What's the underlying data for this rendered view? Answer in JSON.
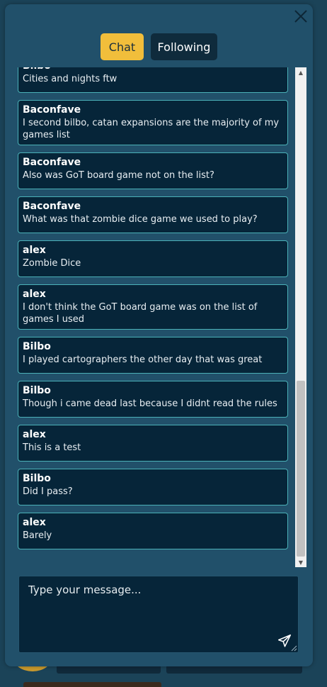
{
  "tabs": {
    "chat": "Chat",
    "following": "Following"
  },
  "messages": [
    {
      "author": "Bilbo",
      "text": "Cities and nights ftw"
    },
    {
      "author": "Baconfave",
      "text": "I second bilbo, catan expansions are the majority of my games list"
    },
    {
      "author": "Baconfave",
      "text": "Also was GoT board game not on the list?"
    },
    {
      "author": "Baconfave",
      "text": "What was that zombie dice game we used to play?"
    },
    {
      "author": "alex",
      "text": "Zombie Dice"
    },
    {
      "author": "alex",
      "text": "I don't think the GoT board game was on the list of games I used"
    },
    {
      "author": "Bilbo",
      "text": "I played cartographers the other day that was great"
    },
    {
      "author": "Bilbo",
      "text": "Though i came dead last because I didnt read the rules"
    },
    {
      "author": "alex",
      "text": "This is a test"
    },
    {
      "author": "Bilbo",
      "text": "Did I pass?"
    },
    {
      "author": "alex",
      "text": "Barely"
    }
  ],
  "input": {
    "placeholder": "Type your message..."
  },
  "icons": {
    "close": "close-icon",
    "send": "send-icon",
    "scroll_up": "scroll-up-icon",
    "scroll_down": "scroll-down-icon"
  },
  "colors": {
    "accent": "#f1be3b",
    "panel": "#21506a",
    "message_bg": "#062539",
    "message_border": "#4bb1b8"
  }
}
